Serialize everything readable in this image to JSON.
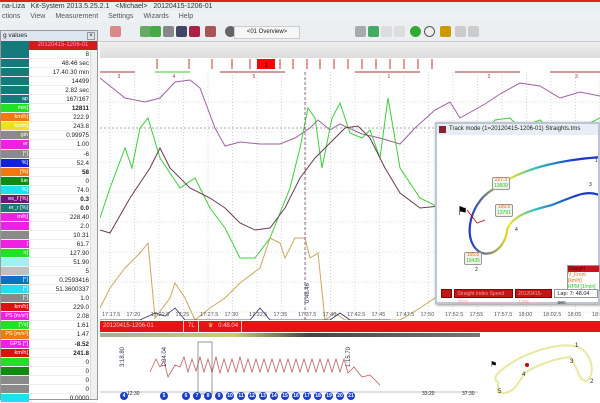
{
  "window": {
    "title": "na-Liza   Kit-System 2013.5.25.2.1   <Michael>   20120415-1206-01"
  },
  "menu": [
    "ctions",
    "View",
    "Measurement",
    "Settings",
    "Wizards",
    "Help"
  ],
  "toolbar": {
    "layout_combo": "<01 Overview>"
  },
  "left_panel": {
    "title": "g values",
    "header_value": "20120415-1206-01",
    "rows": [
      {
        "label": "",
        "value": "8",
        "color": "#157a7a",
        "bold": false
      },
      {
        "label": "",
        "value": "48.46 sec",
        "color": "#157a7a",
        "bold": false
      },
      {
        "label": "",
        "value": "17.40.30 min",
        "color": "#157a7a",
        "bold": false
      },
      {
        "label": "",
        "value": "14499",
        "color": "#157a7a",
        "bold": false
      },
      {
        "label": "",
        "value": "2.82 sec",
        "color": "#157a7a",
        "bold": false
      },
      {
        "label": "ap",
        "value": "167/167",
        "color": "#157a7a",
        "bold": false
      },
      {
        "label": "min]",
        "value": "12811",
        "color": "#22e022",
        "bold": true
      },
      {
        "label": "km/h]",
        "value": "222.9",
        "color": "#f07a10",
        "bold": false
      },
      {
        "label": "km/h]",
        "value": "243.8",
        "color": "#f0e020",
        "bold": false
      },
      {
        "label": "gin",
        "value": "0.99975",
        "color": "#8a8a8a",
        "bold": false
      },
      {
        "label": "er",
        "value": "1.00",
        "color": "#f020e0",
        "bold": false
      },
      {
        "label": "[°]",
        "value": "-6",
        "color": "#8a8a8a",
        "bold": false
      },
      {
        "label": "%]",
        "value": "52.4",
        "color": "#1020e0",
        "bold": false
      },
      {
        "label": "[%]",
        "value": "58",
        "color": "#f07a10",
        "bold": true
      },
      {
        "label": "lue",
        "value": "0",
        "color": "#108a10",
        "bold": false
      },
      {
        "label": "%]",
        "value": "74.0",
        "color": "#20e0f0",
        "bold": false
      },
      {
        "label": "es_f [%]",
        "value": "0.3",
        "color": "#7a107a",
        "bold": true
      },
      {
        "label": "er_r [%]",
        "value": "0.0",
        "color": "#157a7a",
        "bold": true
      },
      {
        "label": "m/h]",
        "value": "228.40",
        "color": "#f020e0",
        "bold": false
      },
      {
        "label": "",
        "value": "2.0",
        "color": "#f020e0",
        "bold": false
      },
      {
        "label": "",
        "value": "10.31",
        "color": "#8a8a8a",
        "bold": false
      },
      {
        "label": "]",
        "value": "61.7",
        "color": "#f020e0",
        "bold": false
      },
      {
        "label": "n]",
        "value": "127.90",
        "color": "#22e022",
        "bold": false
      },
      {
        "label": "",
        "value": "51.90",
        "color": "#a0f0f0",
        "bold": false
      },
      {
        "label": "",
        "value": "5",
        "color": "#c0c0c0",
        "bold": false
      },
      {
        "label": "[°]",
        "value": "0.2593416",
        "color": "#1070c0",
        "bold": false
      },
      {
        "label": "[°]",
        "value": "51.3600337",
        "color": "#20e0f0",
        "bold": false
      },
      {
        "label": "[°]",
        "value": "1.0",
        "color": "#8a8a8a",
        "bold": false
      },
      {
        "label": "km/h]",
        "value": "229.0",
        "color": "#e01010",
        "bold": false
      },
      {
        "label": "PS [m/s²]",
        "value": "2.08",
        "color": "#f020e0",
        "bold": false
      },
      {
        "label": "[°/s]",
        "value": "1.61",
        "color": "#22e022",
        "bold": false
      },
      {
        "label": "PS [m/s²]",
        "value": "1.47",
        "color": "#f07a10",
        "bold": false
      },
      {
        "label": "GPS [°]",
        "value": "-8.52",
        "color": "#f020e0",
        "bold": true
      },
      {
        "label": "km/h]",
        "value": "241.8",
        "color": "#e01010",
        "bold": true
      },
      {
        "label": "",
        "value": "0",
        "color": "#22e022",
        "bold": false
      },
      {
        "label": "",
        "value": "0",
        "color": "#108a10",
        "bold": false
      },
      {
        "label": "",
        "value": "0",
        "color": "#8a8a8a",
        "bold": false
      },
      {
        "label": "",
        "value": "0",
        "color": "#8a8a8a",
        "bold": false
      },
      {
        "label": "",
        "value": "0.0000",
        "color": "#20e0f0",
        "bold": false
      }
    ]
  },
  "main_chart": {
    "x_ticks": [
      "17:17.5",
      "17:20",
      "17:22.5",
      "17:25",
      "17:27.5",
      "17:30",
      "17:32.5",
      "17:35",
      "17:37.5",
      "17:40",
      "17:42.5",
      "17:45",
      "17:47.5",
      "17:50",
      "17:52.5",
      "17:55",
      "17:57.5",
      "18:00",
      "18:02.5",
      "18:05",
      "18:07"
    ],
    "cursor_label": "0:48.46",
    "sector_labels": [
      "3",
      "4",
      "5",
      "1",
      "2",
      "3"
    ],
    "marker_label": "1"
  },
  "status_bar": {
    "session": "20120415-1206-01",
    "lap": "7L",
    "best_lap": "0:48.04"
  },
  "lap_overview": {
    "lap_numbers": [
      "4",
      "5",
      "6",
      "7",
      "8",
      "9",
      "10",
      "11",
      "12",
      "13",
      "14",
      "15",
      "16",
      "17",
      "18",
      "19",
      "20",
      "21"
    ],
    "lap_times": [
      "3:18.80",
      "1:34.04",
      "1:15.70"
    ],
    "x_ticks": [
      "12:30",
      "33:20",
      "37:30"
    ]
  },
  "track_window": {
    "title": "Track mode (1=20120415-1206-01)   Straights.tms",
    "tags": [
      {
        "speed": "227.3",
        "rpm": "13609"
      },
      {
        "speed": "199.5",
        "rpm": "13791"
      },
      {
        "speed": "155.8",
        "rpm": "10435"
      }
    ],
    "corner_numbers": [
      "1",
      "3",
      "4",
      "2"
    ],
    "legend": [
      "Straight",
      "V_Front [km/h]",
      "RPM [1/min]"
    ],
    "status": [
      "",
      "Straight Index Speed 2023",
      "20120415-1206"
    ],
    "lap_info": "Lap: 7: 48.04 sec"
  },
  "minimap": {
    "corner_numbers": [
      "1",
      "3",
      "4",
      "2",
      "5"
    ]
  },
  "colors": {
    "accent": "#e41414",
    "rpm": "#3ccf3c",
    "speed": "#7a3a5a",
    "throttle": "#c8a860",
    "lap_badge": "#1a3ec8"
  }
}
